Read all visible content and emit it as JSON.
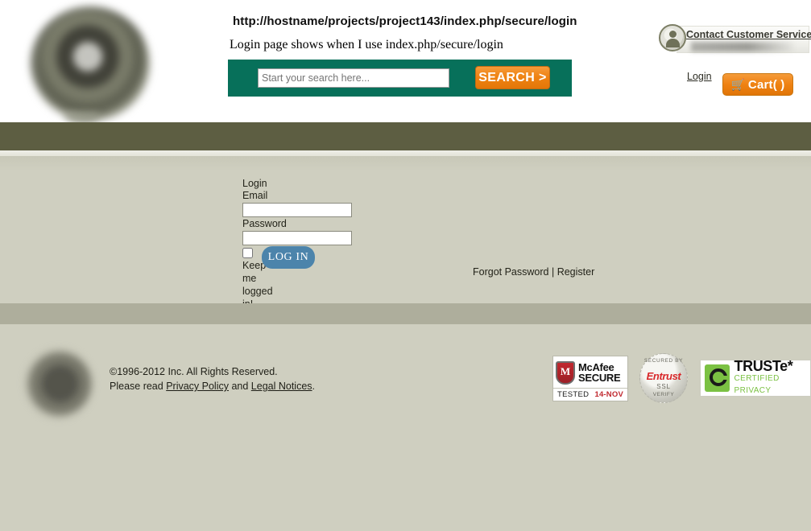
{
  "header": {
    "url_text": "http://hostname/projects/project143/index.php/secure/login",
    "caption": "Login page shows when I use index.php/secure/login",
    "brand_logo_alt": "company-logo",
    "search": {
      "placeholder": "Start your search here...",
      "value": "",
      "button_label": "SEARCH >",
      "strip_color": "#07705a"
    },
    "contact": {
      "label": "Contact Customer Service",
      "icon": "customer-service-person-icon"
    },
    "login_link": "Login",
    "cart": {
      "icon": "shopping-cart-icon",
      "label": "Cart(   )",
      "color": "#ef8212"
    }
  },
  "nav": {
    "bar_color": "#5d5e42"
  },
  "main": {
    "form": {
      "title": "Login",
      "email_label": "Email",
      "email_value": "",
      "password_label": "Password",
      "password_value": "",
      "keep_logged_in_label": "Keep me logged in!",
      "keep_logged_in_checked": false,
      "submit_label": "LOG IN",
      "submit_color": "#4c84ab"
    },
    "aux": {
      "forgot_password": "Forgot Password",
      "separator": " | ",
      "register": "Register"
    },
    "background_color": "#cfcfc0"
  },
  "footer": {
    "logo_alt": "company-logo-footer",
    "copyright": "©1996-2012 Inc. All Rights Reserved.",
    "legal_prefix": "Please read ",
    "privacy_policy": "Privacy Policy",
    "legal_mid": " and ",
    "legal_notices": "Legal Notices",
    "legal_suffix": ".",
    "badges": {
      "mcafee": {
        "word1": "McAfee",
        "word2": "SECURE",
        "tested": "TESTED",
        "date": "14-NOV"
      },
      "entrust": {
        "top": "SECURED BY",
        "name": "Entrust",
        "ssl": "SSL",
        "verify": "VERIFY"
      },
      "truste": {
        "name": "TRUSTe*",
        "tagline": "CERTIFIED PRIVACY"
      }
    }
  }
}
